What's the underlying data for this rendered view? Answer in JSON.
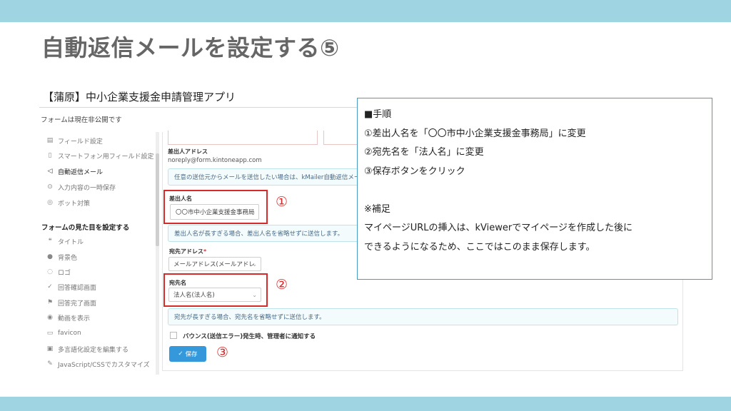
{
  "slide": {
    "title": "自動返信メールを設定する⑤"
  },
  "app": {
    "title": "【蒲原】中小企業支援金申請管理アプリ",
    "form_status": "フォームは現在非公開です"
  },
  "sidebar": {
    "items_top": [
      {
        "label": "フィールド設定",
        "icon": "file-icon"
      },
      {
        "label": "スマートフォン用フィールド設定",
        "icon": "phone-icon"
      },
      {
        "label": "自動返信メール",
        "icon": "send-icon",
        "active": true
      },
      {
        "label": "入力内容の一時保存",
        "icon": "save-draft-icon"
      },
      {
        "label": "ボット対策",
        "icon": "bot-icon"
      }
    ],
    "section_heading": "フォームの見た目を設定する",
    "items_bottom": [
      {
        "label": "タイトル",
        "icon": "title-icon"
      },
      {
        "label": "背景色",
        "icon": "color-drop-icon"
      },
      {
        "label": "ロゴ",
        "icon": "logo-icon"
      },
      {
        "label": "回答確認画面",
        "icon": "check-icon"
      },
      {
        "label": "回答完了画面",
        "icon": "flag-icon"
      },
      {
        "label": "動画を表示",
        "icon": "video-icon"
      },
      {
        "label": "favicon",
        "icon": "favicon-icon"
      },
      {
        "label": "多言語化設定を編集する",
        "icon": "language-icon"
      },
      {
        "label": "JavaScript/CSSでカスタマイズ",
        "icon": "code-icon"
      }
    ]
  },
  "form": {
    "sender_address_label": "差出人アドレス",
    "sender_address_value": "noreply@form.kintoneapp.com",
    "sender_info": "任意の送信元からメールを送信したい場合は、kMailer自動返信メー",
    "sender_name_label": "差出人名",
    "sender_name_value": "〇〇市中小企業支援金事務局",
    "sender_name_info": "差出人名が長すぎる場合、差出人名を省略せずに送信します。",
    "recipient_address_label": "宛先アドレス",
    "recipient_address_required": "*",
    "recipient_address_value": "メールアドレス(メールアドレ",
    "recipient_name_label": "宛先名",
    "recipient_name_value": "法人名(法人名)",
    "recipient_name_info": "宛先が長すぎる場合、宛先名を省略せずに送信します。",
    "bounce_label": "バウンス(送信エラー)発生時、管理者に通知する",
    "save_label": "保存"
  },
  "markers": {
    "one": "①",
    "two": "②",
    "three": "③"
  },
  "note": {
    "lines": [
      "■手順",
      "①差出人名を「〇〇市中小企業支援金事務局」に変更",
      "②宛先名を「法人名」に変更",
      "③保存ボタンをクリック",
      "",
      "※補足",
      "マイページURLの挿入は、kViewerでマイページを作成した後に",
      "できるようになるため、ここではこのまま保存します。"
    ]
  },
  "colors": {
    "band": "#9fd4e2",
    "highlight_red": "#d62b2b",
    "note_border": "#4a9bc4",
    "save_button": "#3498db"
  }
}
